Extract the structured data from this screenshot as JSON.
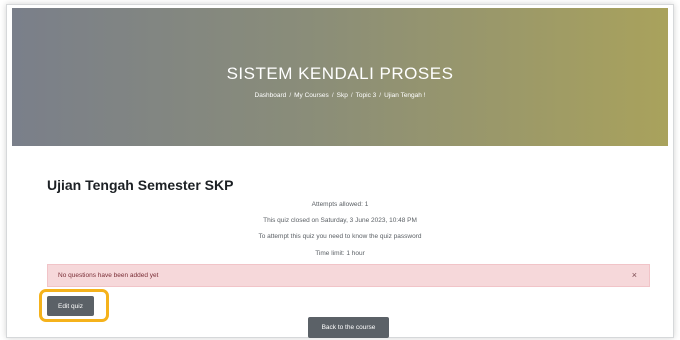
{
  "header": {
    "course_title": "SISTEM KENDALI PROSES",
    "breadcrumb": [
      "Dashboard",
      "My Courses",
      "Skp",
      "Topic 3",
      "Ujian Tengah !"
    ],
    "breadcrumb_separator": "/"
  },
  "quiz": {
    "title": "Ujian Tengah Semester SKP",
    "info": [
      "Attempts allowed: 1",
      "This quiz closed on Saturday, 3 June 2023, 10:48 PM",
      "To attempt this quiz you need to know the quiz password",
      "Time limit: 1 hour"
    ]
  },
  "alert": {
    "text": "No questions have been added yet",
    "close_glyph": "×"
  },
  "buttons": {
    "edit_quiz": "Edit quiz",
    "back_to_course": "Back to the course"
  },
  "colors": {
    "hero_gradient_start": "#7a7f8a",
    "hero_gradient_end": "#a9a25c",
    "alert_background": "#f6d8da",
    "button_background": "#5b6167",
    "highlight_border": "#f5b21b"
  }
}
